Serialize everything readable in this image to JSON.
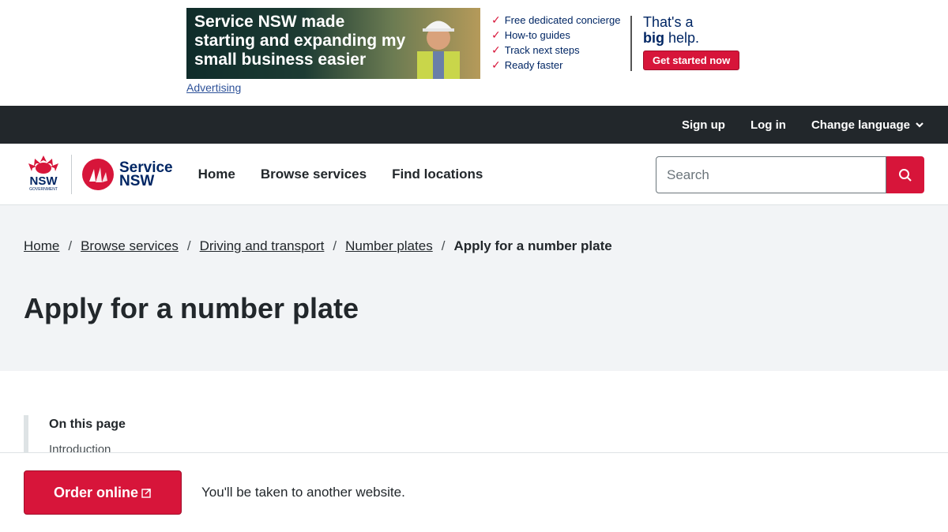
{
  "ad": {
    "headline": "Service NSW made starting and expanding my small business easier",
    "features": [
      "Free dedicated concierge",
      "How-to guides",
      "Track next steps",
      "Ready faster"
    ],
    "tagline_line1": "That's a",
    "tagline_big": "big",
    "tagline_rest": "help.",
    "cta_label": "Get started now",
    "advertising_link": "Advertising"
  },
  "topbar": {
    "sign_up": "Sign up",
    "log_in": "Log in",
    "change_language": "Change language"
  },
  "header": {
    "nsw_logo_text": "NSW",
    "nsw_logo_sub": "GOVERNMENT",
    "service_logo_line1": "Service",
    "service_logo_line2": "NSW",
    "nav": [
      "Home",
      "Browse services",
      "Find locations"
    ],
    "search_placeholder": "Search"
  },
  "breadcrumb": {
    "items": [
      "Home",
      "Browse services",
      "Driving and transport",
      "Number plates"
    ],
    "current": "Apply for a number plate",
    "separator": "/"
  },
  "page": {
    "title": "Apply for a number plate",
    "on_this_page": "On this page",
    "on_this_page_first": "Introduction"
  },
  "sticky": {
    "order_label": "Order online",
    "note": "You'll be taken to another website."
  },
  "colors": {
    "brand_red": "#d7153a",
    "brand_navy": "#002664",
    "dark_bar": "#22272b",
    "hero_bg": "#f2f4f6"
  }
}
